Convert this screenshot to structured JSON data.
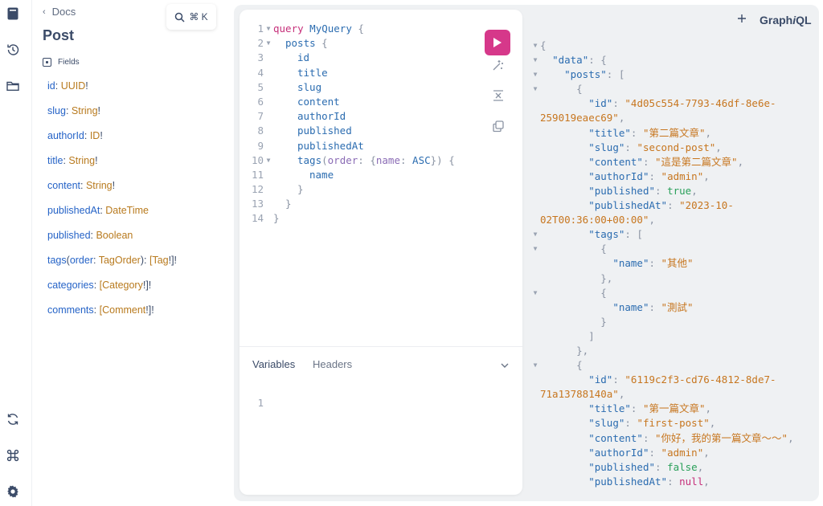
{
  "brand": {
    "pre": "Graph",
    "italic": "i",
    "post": "QL"
  },
  "search": {
    "shortcut": "⌘ K"
  },
  "rail": {
    "icons": [
      "docs-icon",
      "history-icon",
      "folder-icon",
      "refetch-icon",
      "shortcuts-icon",
      "settings-icon"
    ]
  },
  "docs": {
    "back_label": "Docs",
    "title": "Post",
    "section_label": "Fields",
    "fields": [
      {
        "name": "id",
        "type": "UUID",
        "suffix": "!"
      },
      {
        "name": "slug",
        "type": "String",
        "suffix": "!"
      },
      {
        "name": "authorId",
        "type": "ID",
        "suffix": "!"
      },
      {
        "name": "title",
        "type": "String",
        "suffix": "!"
      },
      {
        "name": "content",
        "type": "String",
        "suffix": "!"
      },
      {
        "name": "publishedAt",
        "type": "DateTime",
        "suffix": ""
      },
      {
        "name": "published",
        "type": "Boolean",
        "suffix": ""
      },
      {
        "name": "tags",
        "args": "order",
        "arg_type": "TagOrder",
        "prefix": "[",
        "type": "Tag",
        "suffix": "!]!"
      },
      {
        "name": "categories",
        "prefix": "[",
        "type": "Category",
        "suffix": "!]!"
      },
      {
        "name": "comments",
        "prefix": "[",
        "type": "Comment",
        "suffix": "!]!"
      }
    ]
  },
  "query": {
    "lines": [
      {
        "n": "1",
        "fold": true,
        "indent": 0,
        "parts": [
          [
            "kw",
            "query"
          ],
          [
            "sp",
            " "
          ],
          [
            "op",
            "MyQuery"
          ],
          [
            "sp",
            " "
          ],
          [
            "br",
            "{"
          ]
        ]
      },
      {
        "n": "2",
        "fold": true,
        "indent": 1,
        "parts": [
          [
            "f",
            "posts"
          ],
          [
            "sp",
            " "
          ],
          [
            "br",
            "{"
          ]
        ]
      },
      {
        "n": "3",
        "fold": false,
        "indent": 2,
        "parts": [
          [
            "f",
            "id"
          ]
        ]
      },
      {
        "n": "4",
        "fold": false,
        "indent": 2,
        "parts": [
          [
            "f",
            "title"
          ]
        ]
      },
      {
        "n": "5",
        "fold": false,
        "indent": 2,
        "parts": [
          [
            "f",
            "slug"
          ]
        ]
      },
      {
        "n": "6",
        "fold": false,
        "indent": 2,
        "parts": [
          [
            "f",
            "content"
          ]
        ]
      },
      {
        "n": "7",
        "fold": false,
        "indent": 2,
        "parts": [
          [
            "f",
            "authorId"
          ]
        ]
      },
      {
        "n": "8",
        "fold": false,
        "indent": 2,
        "parts": [
          [
            "f",
            "published"
          ]
        ]
      },
      {
        "n": "9",
        "fold": false,
        "indent": 2,
        "parts": [
          [
            "f",
            "publishedAt"
          ]
        ]
      },
      {
        "n": "10",
        "fold": true,
        "indent": 2,
        "parts": [
          [
            "f",
            "tags"
          ],
          [
            "br",
            "("
          ],
          [
            "arg",
            "order"
          ],
          [
            "br",
            ":"
          ],
          [
            "sp",
            " "
          ],
          [
            "br",
            "{"
          ],
          [
            "arg",
            "name"
          ],
          [
            "br",
            ":"
          ],
          [
            "sp",
            " "
          ],
          [
            "en",
            "ASC"
          ],
          [
            "br",
            "})"
          ],
          [
            "sp",
            " "
          ],
          [
            "br",
            "{"
          ]
        ]
      },
      {
        "n": "11",
        "fold": false,
        "indent": 3,
        "parts": [
          [
            "f",
            "name"
          ]
        ]
      },
      {
        "n": "12",
        "fold": false,
        "indent": 2,
        "parts": [
          [
            "br",
            "}"
          ]
        ]
      },
      {
        "n": "13",
        "fold": false,
        "indent": 1,
        "parts": [
          [
            "br",
            "}"
          ]
        ]
      },
      {
        "n": "14",
        "fold": false,
        "indent": 0,
        "parts": [
          [
            "br",
            "}"
          ]
        ]
      }
    ]
  },
  "variables": {
    "tabs": [
      "Variables",
      "Headers"
    ],
    "lines": [
      "1"
    ]
  },
  "result": {
    "lines": [
      {
        "fold": true,
        "parts": [
          [
            "p",
            "{"
          ]
        ]
      },
      {
        "fold": true,
        "parts": [
          [
            "sp",
            "  "
          ],
          [
            "k",
            "\"data\""
          ],
          [
            "p",
            ": {"
          ]
        ]
      },
      {
        "fold": true,
        "parts": [
          [
            "sp",
            "    "
          ],
          [
            "k",
            "\"posts\""
          ],
          [
            "p",
            ": ["
          ]
        ]
      },
      {
        "fold": true,
        "parts": [
          [
            "sp",
            "      "
          ],
          [
            "p",
            "{"
          ]
        ]
      },
      {
        "fold": false,
        "parts": [
          [
            "sp",
            "        "
          ],
          [
            "k",
            "\"id\""
          ],
          [
            "p",
            ": "
          ],
          [
            "s",
            "\"4d05c554-7793-46df-8e6e-"
          ]
        ]
      },
      {
        "fold": false,
        "parts": [
          [
            "s",
            "259019eaec69\""
          ],
          [
            "p",
            ","
          ]
        ]
      },
      {
        "fold": false,
        "parts": [
          [
            "sp",
            "        "
          ],
          [
            "k",
            "\"title\""
          ],
          [
            "p",
            ": "
          ],
          [
            "s",
            "\"第二篇文章\""
          ],
          [
            "p",
            ","
          ]
        ]
      },
      {
        "fold": false,
        "parts": [
          [
            "sp",
            "        "
          ],
          [
            "k",
            "\"slug\""
          ],
          [
            "p",
            ": "
          ],
          [
            "s",
            "\"second-post\""
          ],
          [
            "p",
            ","
          ]
        ]
      },
      {
        "fold": false,
        "parts": [
          [
            "sp",
            "        "
          ],
          [
            "k",
            "\"content\""
          ],
          [
            "p",
            ": "
          ],
          [
            "s",
            "\"這是第二篇文章\""
          ],
          [
            "p",
            ","
          ]
        ]
      },
      {
        "fold": false,
        "parts": [
          [
            "sp",
            "        "
          ],
          [
            "k",
            "\"authorId\""
          ],
          [
            "p",
            ": "
          ],
          [
            "s",
            "\"admin\""
          ],
          [
            "p",
            ","
          ]
        ]
      },
      {
        "fold": false,
        "parts": [
          [
            "sp",
            "        "
          ],
          [
            "k",
            "\"published\""
          ],
          [
            "p",
            ": "
          ],
          [
            "b",
            "true"
          ],
          [
            "p",
            ","
          ]
        ]
      },
      {
        "fold": false,
        "parts": [
          [
            "sp",
            "        "
          ],
          [
            "k",
            "\"publishedAt\""
          ],
          [
            "p",
            ": "
          ],
          [
            "s",
            "\"2023-10-"
          ]
        ]
      },
      {
        "fold": false,
        "parts": [
          [
            "s",
            "02T00:36:00+00:00\""
          ],
          [
            "p",
            ","
          ]
        ]
      },
      {
        "fold": true,
        "parts": [
          [
            "sp",
            "        "
          ],
          [
            "k",
            "\"tags\""
          ],
          [
            "p",
            ": ["
          ]
        ]
      },
      {
        "fold": true,
        "parts": [
          [
            "sp",
            "          "
          ],
          [
            "p",
            "{"
          ]
        ]
      },
      {
        "fold": false,
        "parts": [
          [
            "sp",
            "            "
          ],
          [
            "k",
            "\"name\""
          ],
          [
            "p",
            ": "
          ],
          [
            "s",
            "\"其他\""
          ]
        ]
      },
      {
        "fold": false,
        "parts": [
          [
            "sp",
            "          "
          ],
          [
            "p",
            "},"
          ]
        ]
      },
      {
        "fold": true,
        "parts": [
          [
            "sp",
            "          "
          ],
          [
            "p",
            "{"
          ]
        ]
      },
      {
        "fold": false,
        "parts": [
          [
            "sp",
            "            "
          ],
          [
            "k",
            "\"name\""
          ],
          [
            "p",
            ": "
          ],
          [
            "s",
            "\"測試\""
          ]
        ]
      },
      {
        "fold": false,
        "parts": [
          [
            "sp",
            "          "
          ],
          [
            "p",
            "}"
          ]
        ]
      },
      {
        "fold": false,
        "parts": [
          [
            "sp",
            "        "
          ],
          [
            "p",
            "]"
          ]
        ]
      },
      {
        "fold": false,
        "parts": [
          [
            "sp",
            "      "
          ],
          [
            "p",
            "},"
          ]
        ]
      },
      {
        "fold": true,
        "parts": [
          [
            "sp",
            "      "
          ],
          [
            "p",
            "{"
          ]
        ]
      },
      {
        "fold": false,
        "parts": [
          [
            "sp",
            "        "
          ],
          [
            "k",
            "\"id\""
          ],
          [
            "p",
            ": "
          ],
          [
            "s",
            "\"6119c2f3-cd76-4812-8de7-"
          ]
        ]
      },
      {
        "fold": false,
        "parts": [
          [
            "s",
            "71a13788140a\""
          ],
          [
            "p",
            ","
          ]
        ]
      },
      {
        "fold": false,
        "parts": [
          [
            "sp",
            "        "
          ],
          [
            "k",
            "\"title\""
          ],
          [
            "p",
            ": "
          ],
          [
            "s",
            "\"第一篇文章\""
          ],
          [
            "p",
            ","
          ]
        ]
      },
      {
        "fold": false,
        "parts": [
          [
            "sp",
            "        "
          ],
          [
            "k",
            "\"slug\""
          ],
          [
            "p",
            ": "
          ],
          [
            "s",
            "\"first-post\""
          ],
          [
            "p",
            ","
          ]
        ]
      },
      {
        "fold": false,
        "parts": [
          [
            "sp",
            "        "
          ],
          [
            "k",
            "\"content\""
          ],
          [
            "p",
            ": "
          ],
          [
            "s",
            "\"你好，我的第一篇文章～～\""
          ],
          [
            "p",
            ","
          ]
        ]
      },
      {
        "fold": false,
        "parts": [
          [
            "sp",
            "        "
          ],
          [
            "k",
            "\"authorId\""
          ],
          [
            "p",
            ": "
          ],
          [
            "s",
            "\"admin\""
          ],
          [
            "p",
            ","
          ]
        ]
      },
      {
        "fold": false,
        "parts": [
          [
            "sp",
            "        "
          ],
          [
            "k",
            "\"published\""
          ],
          [
            "p",
            ": "
          ],
          [
            "b",
            "false"
          ],
          [
            "p",
            ","
          ]
        ]
      },
      {
        "fold": false,
        "parts": [
          [
            "sp",
            "        "
          ],
          [
            "k",
            "\"publishedAt\""
          ],
          [
            "p",
            ": "
          ],
          [
            "n",
            "null"
          ],
          [
            "p",
            ","
          ]
        ]
      }
    ]
  },
  "colors": {
    "run_button": "#d6388a",
    "field_name": "#2563c7",
    "field_type": "#b87a1e",
    "json_string": "#c7761f",
    "json_key": "#2b6cb0",
    "json_bool": "#2aa05a",
    "json_null": "#c62f7a"
  }
}
